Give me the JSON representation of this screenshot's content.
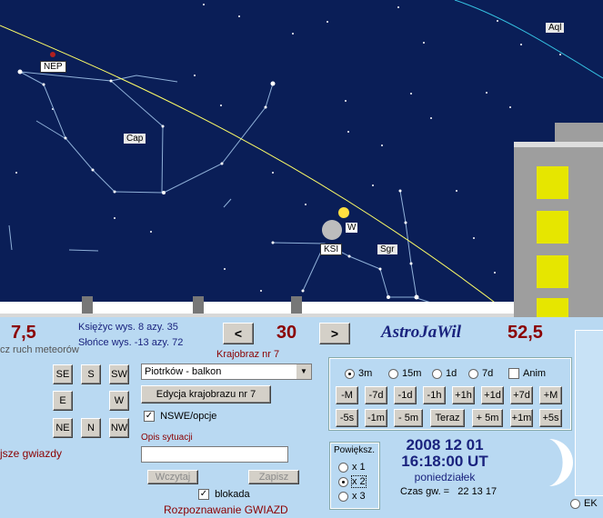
{
  "sky": {
    "labels": {
      "nep": "NEP",
      "cap": "Cap",
      "aql": "Aql",
      "sgr": "Sgr",
      "ksi": "KSI",
      "sun_tag": "W"
    }
  },
  "left": {
    "big_value": "7,5",
    "meteor_caption": "cz ruch meteorów",
    "brightest_caption": "jsze gwiazdy"
  },
  "info": {
    "moon": "Księżyc wys. 8   azy. 35",
    "sun": "Słońce wys. -13   azy. 72"
  },
  "landscape": {
    "prev_label": "<",
    "next_label": ">",
    "number": "30",
    "caption": "Krajobraz nr 7",
    "select_value": "Piotrków - balkon",
    "edit_button": "Edycja krajobrazu nr 7",
    "nswe_label": "NSWE/opcje",
    "nswe_checked": true
  },
  "app": {
    "title": "AstroJaWil",
    "right_value": "52,5"
  },
  "compass": {
    "se": "SE",
    "s": "S",
    "sw": "SW",
    "e": "E",
    "w": "W",
    "ne": "NE",
    "n": "N",
    "nw": "NW"
  },
  "situation": {
    "label": "Opis sytuacji",
    "input_value": "",
    "load_button": "Wczytaj",
    "save_button": "Zapisz",
    "lock_label": "blokada",
    "lock_checked": true,
    "recognize": "Rozpoznawanie GWIAZD"
  },
  "step": {
    "options": [
      "3m",
      "15m",
      "1d",
      "7d"
    ],
    "selected": "3m",
    "anim_label": "Anim",
    "row1": [
      "-M",
      "-7d",
      "-1d",
      "-1h",
      "+1h",
      "+1d",
      "+7d",
      "+M"
    ],
    "row2": [
      "-5s",
      "-1m",
      "- 5m",
      "Teraz",
      "+ 5m",
      "+1m",
      "+5s"
    ]
  },
  "zoom": {
    "title": "Powiększ.",
    "options": [
      "x 1",
      "x 2",
      "x 3"
    ],
    "selected": "x 2"
  },
  "datetime": {
    "date": "2008 12 01",
    "time": "16:18:00 UT",
    "weekday": "poniedziałek",
    "sidereal": "Czas gw. =   22 13 17"
  },
  "ek_label": "EK",
  "colors": {
    "sky": "#0a1e57",
    "ecliptic": "#ffff66",
    "accent_red": "#8b0000",
    "title_blue": "#1a237e",
    "panel": "#b9d9f2"
  }
}
